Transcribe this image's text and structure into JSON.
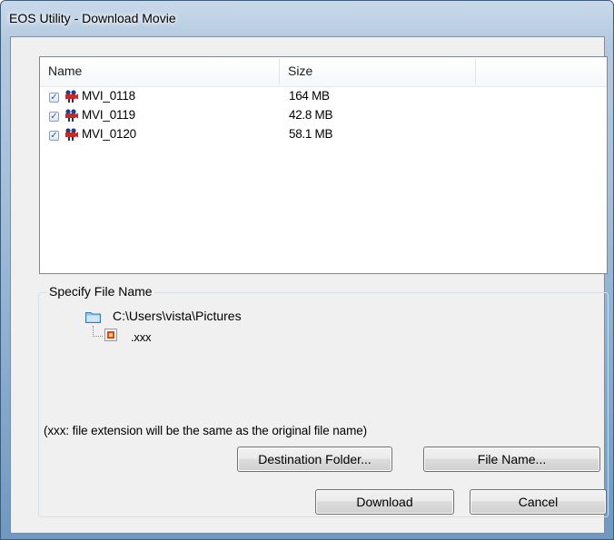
{
  "window": {
    "title": "EOS Utility - Download Movie"
  },
  "list": {
    "columns": [
      "Name",
      "Size"
    ],
    "rows": [
      {
        "name": "MVI_0118",
        "size": "164 MB",
        "checked": true
      },
      {
        "name": "MVI_0119",
        "size": "42.8 MB",
        "checked": true
      },
      {
        "name": "MVI_0120",
        "size": "58.1 MB",
        "checked": true
      }
    ]
  },
  "file_name_group": {
    "legend": "Specify File Name",
    "folder_path": "C:\\Users\\vista\\Pictures",
    "file_extension": ".xxx",
    "note": "(xxx: file extension will be the same as the original file name)",
    "destination_button": "Destination Folder...",
    "file_name_button": "File Name..."
  },
  "actions": {
    "download": "Download",
    "cancel": "Cancel"
  },
  "icons": {
    "movie": "movie-camera-icon",
    "folder": "folder-icon",
    "file": "movie-file-icon"
  },
  "colors": {
    "frame": "#a9c2dc",
    "client": "#f0f0f0",
    "check": "#2a5a96"
  }
}
